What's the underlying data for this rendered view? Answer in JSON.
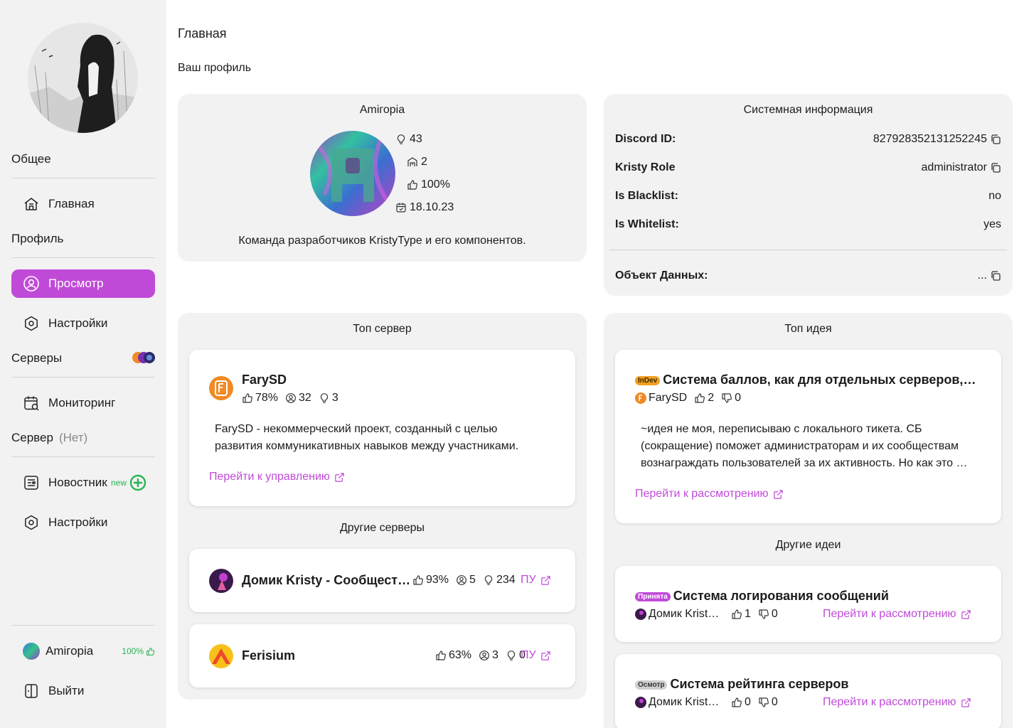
{
  "sidebar": {
    "sections": {
      "general": "Общее",
      "profile": "Профиль",
      "servers": "Серверы",
      "server": "Сервер",
      "server_muted": "(Нет)"
    },
    "items": {
      "home": "Главная",
      "view": "Просмотр",
      "settings1": "Настройки",
      "monitoring": "Мониторинг",
      "news": "Новостник",
      "news_tag": "new",
      "settings2": "Настройки"
    },
    "user": {
      "name": "Amiгоpia",
      "pct": "100%"
    },
    "logout": "Выйти"
  },
  "main": {
    "title": "Главная",
    "subtitle": "Ваш профиль"
  },
  "profile": {
    "name": "Amiгоpia",
    "ideas": "43",
    "servers": "2",
    "rating": "100%",
    "date": "18.10.23",
    "description": "Команда разработчиков KristyType и его компонентов."
  },
  "system": {
    "title": "Системная информация",
    "rows": [
      {
        "k": "Discord ID:",
        "v": "827928352131252245"
      },
      {
        "k": "Kristy Role",
        "v": "administrator"
      },
      {
        "k": "Is Blacklist:",
        "v": "no"
      },
      {
        "k": "Is Whitelist:",
        "v": "yes"
      }
    ],
    "data_object": {
      "k": "Объект Данных:",
      "v": "..."
    }
  },
  "top_server": {
    "title": "Топ сервер",
    "name": "FarySD",
    "likes": "78%",
    "members": "32",
    "ideas": "3",
    "desc1": "FarySD - некоммерческий проект, созданный с целью",
    "desc2": "развития коммуникативных навыков между участниками.",
    "link": "Перейти к управлению"
  },
  "other_servers": {
    "title": "Другие серверы",
    "items": [
      {
        "name": "Домик Kristy - Сообщество Kristy",
        "likes": "93%",
        "members": "5",
        "ideas": "234",
        "link": "ПУ"
      },
      {
        "name": "Ferisium",
        "likes": "63%",
        "members": "3",
        "ideas": "0",
        "link": "ПУ"
      }
    ]
  },
  "top_idea": {
    "title": "Топ идея",
    "badge": "InDev",
    "name": "Система баллов, как для отдельных серверов, так и для",
    "server": "FarySD",
    "up": "2",
    "down": "0",
    "desc1": "~идея не моя, переписываю с локального тикета. СБ",
    "desc2": "(сокращение) поможет администраторам и их сообществам",
    "desc3": "вознаграждать пользователей за их активность. Но как это сделать",
    "link": "Перейти к рассмотрению"
  },
  "other_ideas": {
    "title": "Другие идеи",
    "items": [
      {
        "badge": "Принята",
        "name": "Система логирования сообщений",
        "server": "Домик Kristy - Сообщество",
        "up": "1",
        "down": "0",
        "link": "Перейти к рассмотрению"
      },
      {
        "badge": "Осмотр",
        "name": "Система рейтинга серверов",
        "server": "Домик Kristy - Сообщество",
        "up": "0",
        "down": "0",
        "link": "Перейти к рассмотрению"
      }
    ]
  },
  "colors": {
    "accent": "#c04ad8",
    "green": "#29b352",
    "card": "#f2f2f2",
    "indev": "#f0a020",
    "accepted": "#c04ad8",
    "review": "#cfcfcf"
  }
}
